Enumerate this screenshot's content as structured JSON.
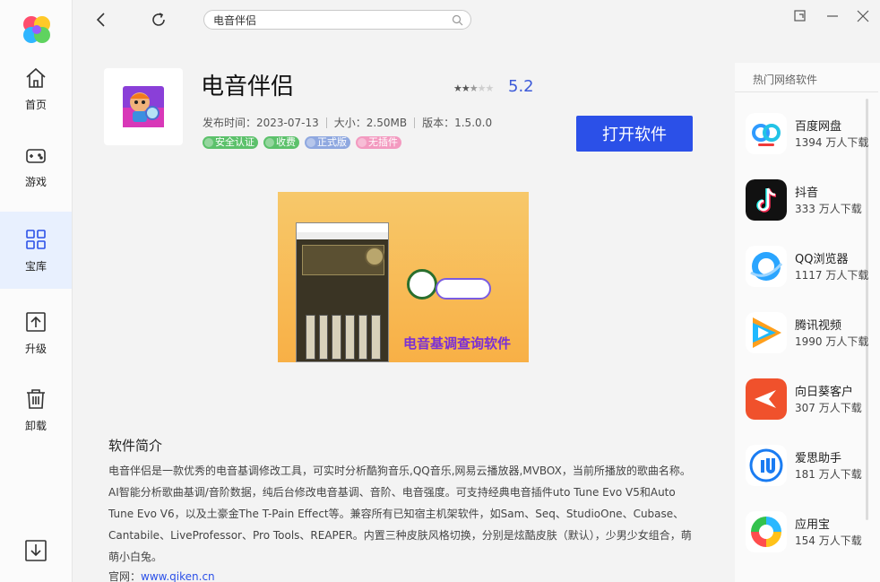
{
  "nav": {
    "items": [
      {
        "label": "首页",
        "icon": "home-icon"
      },
      {
        "label": "游戏",
        "icon": "gamepad-icon"
      },
      {
        "label": "宝库",
        "icon": "apps-grid-icon"
      },
      {
        "label": "升级",
        "icon": "upgrade-icon"
      },
      {
        "label": "卸载",
        "icon": "trash-icon"
      }
    ],
    "active": "宝库"
  },
  "topbar": {
    "search_value": "电音伴侣"
  },
  "app": {
    "name": "电音伴侣",
    "rating": "5.2",
    "rating_stars": 2.5,
    "release_label": "发布时间：",
    "release_date": "2023-07-13",
    "size_label": "大小：",
    "size": "2.50MB",
    "version_label": "版本：",
    "version": "1.5.0.0",
    "tags": [
      {
        "label": "安全认证",
        "color": "#5cc16b"
      },
      {
        "label": "收费",
        "color": "#5cc16b"
      },
      {
        "label": "正式版",
        "color": "#8fa8e0"
      },
      {
        "label": "无插件",
        "color": "#f39ac0"
      }
    ],
    "open_button": "打开软件",
    "screenshot_caption": "电音基调查询软件"
  },
  "intro": {
    "title": "软件简介",
    "body": "电音伴侣是一款优秀的电音基调修改工具，可实时分析酷狗音乐,QQ音乐,网易云播放器,MVBOX，当前所播放的歌曲名称。AI智能分析歌曲基调/音阶数据，纯后台修改电音基调、音阶、电音强度。可支持经典电音插件uto Tune Evo V5和Auto Tune Evo V6，以及土豪金The T-Pain Effect等。兼容所有已知宿主机架软件，如Sam、Seq、StudioOne、Cubase、Cantabile、LiveProfessor、Pro Tools、REAPER。内置三种皮肤风格切换，分别是炫酷皮肤（默认），少男少女组合，萌萌小白兔。",
    "site_label": "官网：",
    "site_url": "www.qiken.cn"
  },
  "hot": {
    "title": "热门网络软件",
    "items": [
      {
        "name": "百度网盘",
        "downloads": "1394 万人下载",
        "color": "#ffffff"
      },
      {
        "name": "抖音",
        "downloads": "333 万人下载",
        "color": "#111111"
      },
      {
        "name": "QQ浏览器",
        "downloads": "1117 万人下载",
        "color": "#ffffff"
      },
      {
        "name": "腾讯视频",
        "downloads": "1990 万人下载",
        "color": "#ffffff"
      },
      {
        "name": "向日葵客户",
        "downloads": "307 万人下载",
        "color": "#f0512c"
      },
      {
        "name": "爱思助手",
        "downloads": "181 万人下载",
        "color": "#ffffff"
      },
      {
        "name": "应用宝",
        "downloads": "154 万人下载",
        "color": "#ffffff"
      }
    ]
  }
}
